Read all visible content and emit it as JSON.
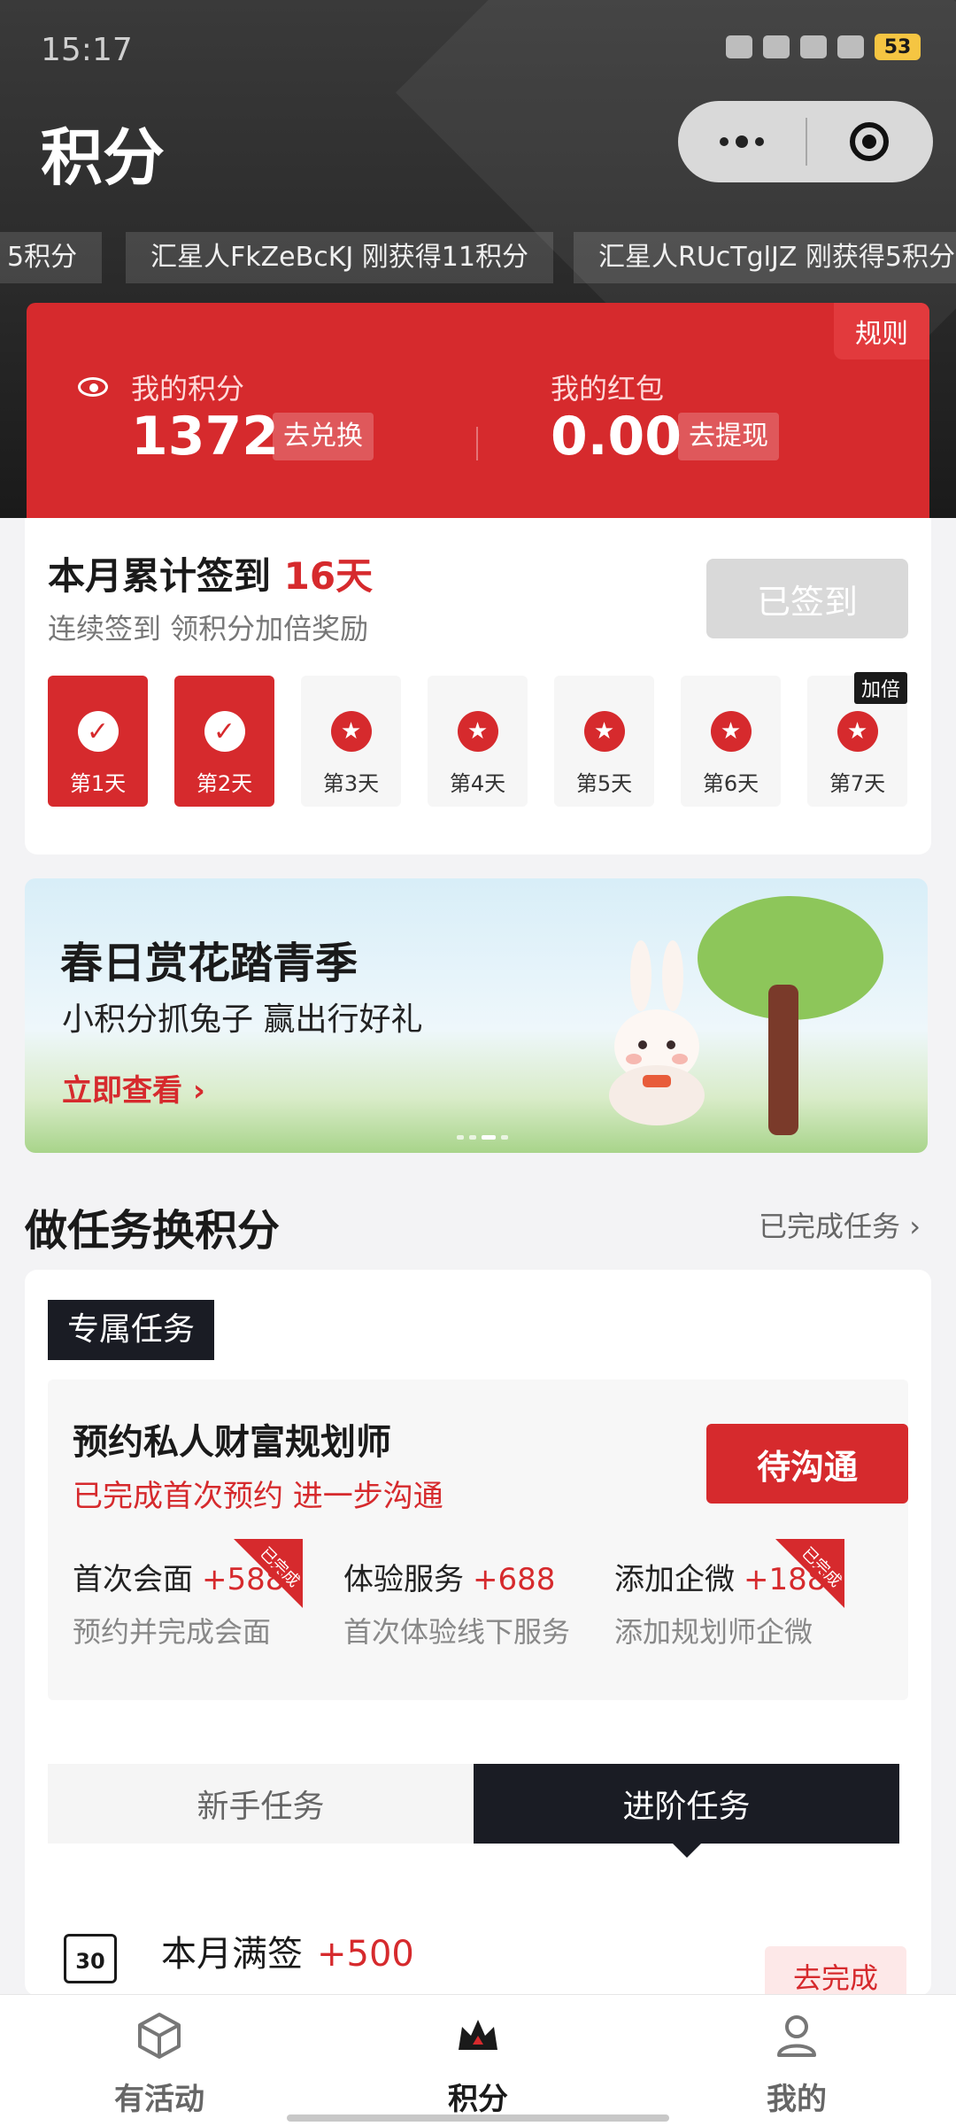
{
  "status_bar": {
    "time": "15:17",
    "battery": "53"
  },
  "header": {
    "title": "积分"
  },
  "ticker": [
    "5积分",
    "汇星人FkZeBcKJ 刚获得11积分",
    "汇星人RUcTglJZ 刚获得5积分"
  ],
  "points_card": {
    "rules": "规则",
    "points_label": "我的积分",
    "points_value": "1372",
    "redeem": "去兑换",
    "redpacket_label": "我的红包",
    "redpacket_value": "0.00",
    "withdraw": "去提现"
  },
  "checkin": {
    "title_prefix": "本月累计签到",
    "days_count": "16天",
    "subtitle": "连续签到 领积分加倍奖励",
    "signed_button": "已签到",
    "double_tag": "加倍",
    "days": [
      {
        "label": "第1天",
        "done": true
      },
      {
        "label": "第2天",
        "done": true
      },
      {
        "label": "第3天",
        "done": false
      },
      {
        "label": "第4天",
        "done": false
      },
      {
        "label": "第5天",
        "done": false
      },
      {
        "label": "第6天",
        "done": false
      },
      {
        "label": "第7天",
        "done": false
      }
    ]
  },
  "banner": {
    "title": "春日赏花踏青季",
    "subtitle": "小积分抓兔子 赢出行好礼",
    "link": "立即查看"
  },
  "tasks_section": {
    "title": "做任务换积分",
    "completed_link": "已完成任务"
  },
  "exclusive": {
    "tag": "专属任务",
    "title": "预约私人财富规划师",
    "subtitle": "已完成首次预约 进一步沟通",
    "button": "待沟通",
    "done_tag": "已完成",
    "subtasks": [
      {
        "name": "首次会面",
        "points": "+588",
        "desc": "预约并完成会面",
        "done": true
      },
      {
        "name": "体验服务",
        "points": "+688",
        "desc": "首次体验线下服务",
        "done": false
      },
      {
        "name": "添加企微",
        "points": "+188",
        "desc": "添加规划师企微",
        "done": true
      }
    ]
  },
  "task_tabs": {
    "newbie": "新手任务",
    "advanced": "进阶任务"
  },
  "task_item": {
    "calendar_day": "30",
    "name": "本月满签",
    "points": "+500",
    "button": "去完成"
  },
  "bottom_nav": {
    "activity": "有活动",
    "points": "积分",
    "mine": "我的"
  },
  "colors": {
    "accent_red": "#d62a2d",
    "dark": "#1a1c24"
  }
}
